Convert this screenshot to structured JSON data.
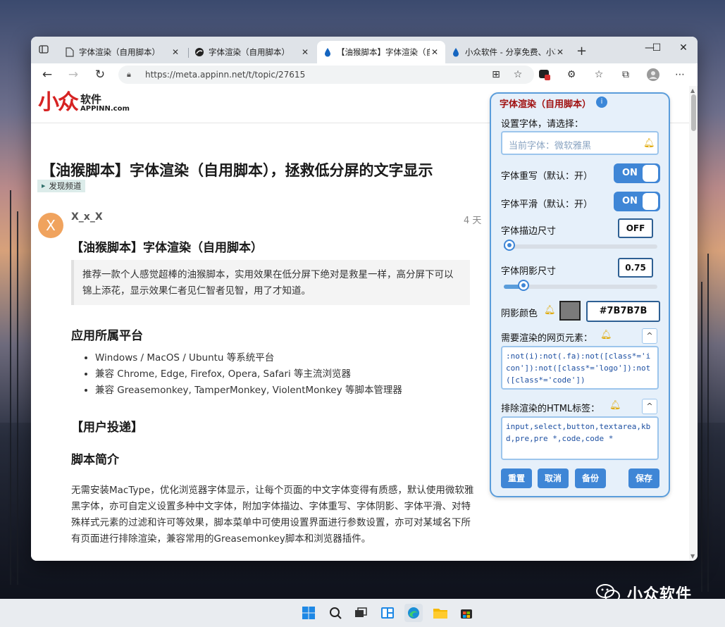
{
  "browser": {
    "tabs": [
      {
        "label": "字体渲染（自用脚本）",
        "icon": "page-icon"
      },
      {
        "label": "字体渲染（自用脚本）",
        "icon": "globe-icon"
      },
      {
        "label": "【油猴脚本】字体渲染（自用",
        "icon": "droplet-icon"
      },
      {
        "label": "小众软件 - 分享免费、小巧",
        "icon": "droplet-icon"
      }
    ],
    "url": "https://meta.appinn.net/t/topic/27615"
  },
  "site": {
    "logo_big": "小众",
    "logo_cn": "软件",
    "logo_en": "APPINN.com"
  },
  "article": {
    "title": "【油猴脚本】字体渲染（自用脚本），拯救低分屏的文字显示",
    "category": "发现频道",
    "avatar_letter": "X",
    "author": "X_x_X",
    "date": "4 天",
    "heading": "【油猴脚本】字体渲染（自用脚本）",
    "quote": "推荐一款个人感觉超棒的油猴脚本，实用效果在低分屏下绝对是救星一样，高分屏下可以锦上添花，显示效果仁者见仁智者见智，用了才知道。",
    "platform_heading": "应用所属平台",
    "platforms": [
      "Windows / MacOS / Ubuntu 等系统平台",
      "兼容 Chrome, Edge, Firefox, Opera, Safari 等主流浏览器",
      "兼容 Greasemonkey, TamperMonkey, ViolentMonkey 等脚本管理器"
    ],
    "user_submit": "【用户投递】",
    "intro_heading": "脚本简介",
    "intro": "无需安装MacType，优化浏览器字体显示，让每个页面的中文字体变得有质感，默认使用微软雅黑字体，亦可自定义设置多种中文字体，附加字体描边、字体重写、字体阴影、字体平滑、对特殊样式元素的过滤和许可等效果，脚本菜单中可使用设置界面进行参数设置，亦可对某域名下所有页面进行排除渲染，兼容常用的Greasemonkey脚本和浏览器插件。"
  },
  "panel": {
    "title": "字体渲染（自用脚本）",
    "font_label": "设置字体，请选择：",
    "font_placeholder": "当前字体：微软雅黑",
    "rewrite_label": "字体重写（默认：开）",
    "rewrite_state": "ON",
    "smooth_label": "字体平滑（默认：开）",
    "smooth_state": "ON",
    "stroke_label": "字体描边尺寸",
    "stroke_value": "OFF",
    "stroke_level": 0,
    "shadow_label": "字体阴影尺寸",
    "shadow_value": "0.75",
    "shadow_level": 0.1,
    "shadow_color_label": "阴影颜色",
    "shadow_color": "#7B7B7B",
    "elements_label": "需要渲染的网页元素：",
    "elements_code": ":not(i):not(.fa):not([class*='icon']):not([class*='logo']):not([class*='code'])",
    "exclude_label": "排除渲染的HTML标签：",
    "exclude_code": "input,select,button,textarea,kbd,pre,pre *,code,code *",
    "buttons": {
      "reset": "重置",
      "cancel": "取消",
      "backup": "备份",
      "save": "保存"
    }
  },
  "watermark": {
    "text": "小众软件"
  },
  "colors": {
    "accent": "#3f86d6",
    "panel_bg": "#e6f0fa",
    "logo_red": "#d62222",
    "title_red": "#a01010"
  }
}
